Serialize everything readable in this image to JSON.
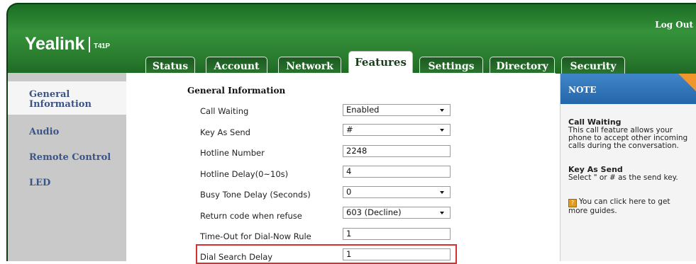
{
  "header": {
    "logo_text": "Yealink",
    "model": "T41P",
    "logout": "Log Out"
  },
  "tabs": [
    {
      "label": "Status"
    },
    {
      "label": "Account"
    },
    {
      "label": "Network"
    },
    {
      "label": "Features",
      "active": true
    },
    {
      "label": "Settings"
    },
    {
      "label": "Directory"
    },
    {
      "label": "Security"
    }
  ],
  "sidebar": {
    "items": [
      {
        "label": "General Information",
        "line1": "General",
        "line2": "Information",
        "active": true
      },
      {
        "label": "Audio"
      },
      {
        "label": "Remote Control"
      },
      {
        "label": "LED"
      }
    ]
  },
  "main": {
    "section_title": "General Information",
    "rows": [
      {
        "label": "Call Waiting",
        "value": "Enabled",
        "type": "select"
      },
      {
        "label": "Key As Send",
        "value": "#",
        "type": "select"
      },
      {
        "label": "Hotline Number",
        "value": "2248",
        "type": "text"
      },
      {
        "label": "Hotline Delay(0~10s)",
        "value": "4",
        "type": "text"
      },
      {
        "label": "Busy Tone Delay (Seconds)",
        "value": "0",
        "type": "select"
      },
      {
        "label": "Return code when refuse",
        "value": "603 (Decline)",
        "type": "select"
      },
      {
        "label": "Time-Out for Dial-Now Rule",
        "value": "1",
        "type": "text"
      },
      {
        "label": "Dial Search Delay",
        "value": "1",
        "type": "text",
        "highlighted": true
      }
    ]
  },
  "note": {
    "title": "NOTE",
    "call_waiting_title": "Call Waiting",
    "call_waiting_lines": [
      "This call feature allows your",
      "phone to accept other incoming",
      "calls during the conversation."
    ],
    "key_as_send_title": "Key As Send",
    "key_as_send_line": "Select \" or # as the send key.",
    "guide_lines": [
      "You can click here to get",
      "more guides."
    ],
    "tip_icon": "?"
  },
  "colors": {
    "header_green": "#2a7d2f",
    "sidebar_gray": "#c9c9c9",
    "link_blue": "#39558a",
    "note_blue": "#2f75bb",
    "note_corner": "#f0962c",
    "highlight_red": "#d83030"
  }
}
